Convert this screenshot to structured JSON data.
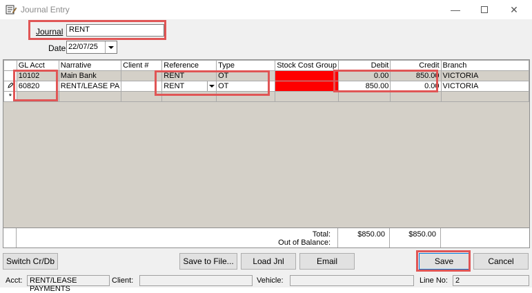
{
  "window": {
    "title": "Journal Entry",
    "icon": "journal-icon",
    "controls": [
      "minimize-icon",
      "maximize-icon",
      "close-icon"
    ]
  },
  "header": {
    "journal_label": "Journal",
    "journal_value": "RENT",
    "date_label": "Date",
    "date_value": "22/07/25"
  },
  "grid": {
    "columns": [
      "GL Acct",
      "Narrative",
      "Client #",
      "Reference",
      "Type",
      "Stock Cost Group",
      "Debit",
      "Credit",
      "Branch"
    ],
    "rows": [
      {
        "gl_acct": "10102",
        "narrative": "Main Bank",
        "client": "",
        "reference": "RENT",
        "type": "OT",
        "stock_cost_group": "",
        "debit": "0.00",
        "credit": "850.00",
        "branch": "VICTORIA"
      },
      {
        "gl_acct": "60820",
        "narrative": "RENT/LEASE PA",
        "client": "",
        "reference": "RENT",
        "type": "OT",
        "stock_cost_group": "",
        "debit": "850.00",
        "credit": "0.00",
        "branch": "VICTORIA"
      }
    ],
    "new_row_marker": "*",
    "stock_cost_group_color": "#ff0000"
  },
  "totals": {
    "total_label": "Total:",
    "oob_label": "Out of Balance:",
    "debit_total": "$850.00",
    "credit_total": "$850.00"
  },
  "buttons": {
    "switch": "Switch Cr/Db",
    "save_to_file": "Save to File...",
    "load_jnl": "Load Jnl",
    "email": "Email",
    "save": "Save",
    "cancel": "Cancel"
  },
  "status": {
    "acct_label": "Acct:",
    "acct_value": "RENT/LEASE PAYMENTS",
    "client_label": "Client:",
    "client_value": "",
    "vehicle_label": "Vehicle:",
    "vehicle_value": "",
    "line_label": "Line No:",
    "line_value": "2"
  },
  "highlight_color": "#e05555"
}
